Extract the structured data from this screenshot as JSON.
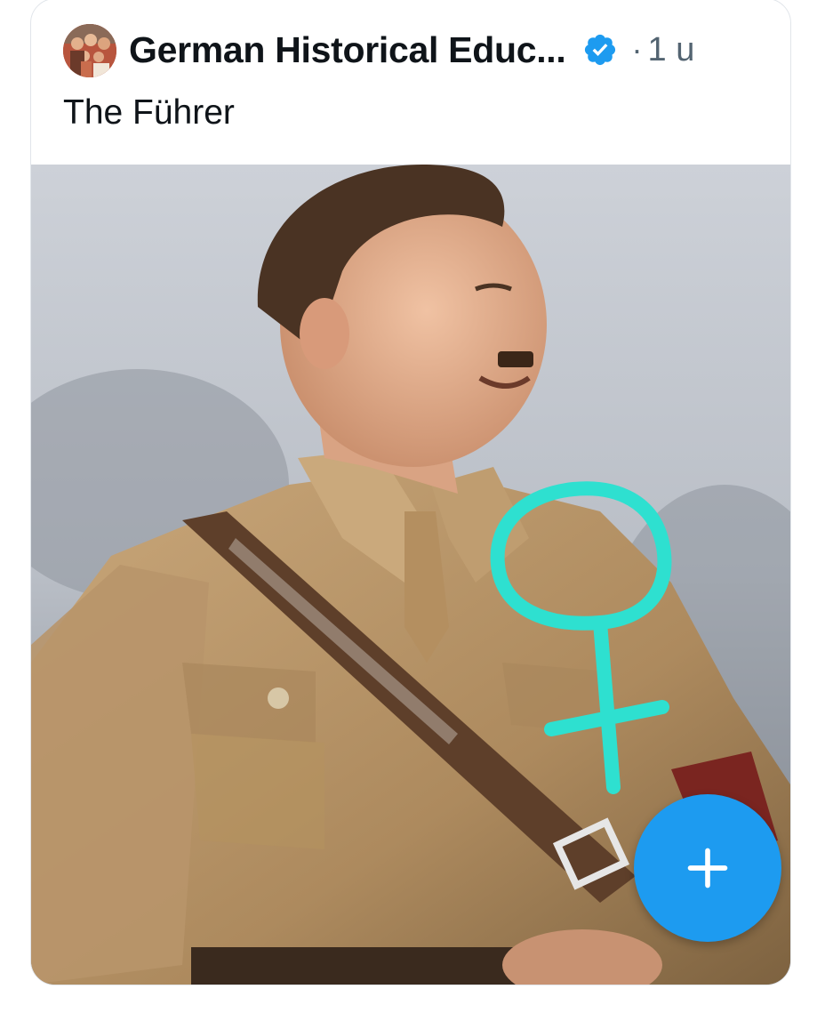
{
  "post": {
    "author_name": "German Historical Educ...",
    "verified_icon": "verified-badge-icon",
    "separator": "·",
    "time": "1 u",
    "text": "The Führer"
  },
  "media": {
    "icon": "photo"
  },
  "fab": {
    "icon": "plus-icon"
  },
  "colors": {
    "accent": "#1d9bf0",
    "text_primary": "#0f1419",
    "text_secondary": "#536471",
    "drawing_stroke": "#2ee0d0"
  }
}
